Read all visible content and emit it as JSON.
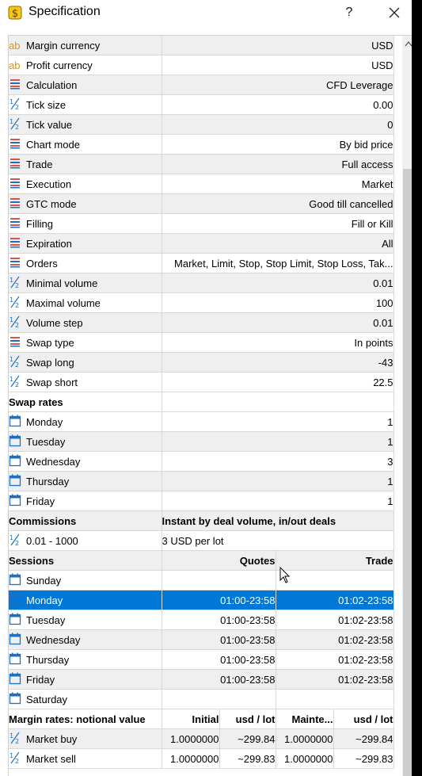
{
  "window": {
    "title": "Specification",
    "help": "?"
  },
  "props": [
    {
      "icon": "ab-icon",
      "name": "Margin currency",
      "value": "USD"
    },
    {
      "icon": "ab-icon",
      "name": "Profit currency",
      "value": "USD"
    },
    {
      "icon": "list-icon",
      "name": "Calculation",
      "value": "CFD Leverage"
    },
    {
      "icon": "half-icon",
      "name": "Tick size",
      "value": "0.00"
    },
    {
      "icon": "half-icon",
      "name": "Tick value",
      "value": "0"
    },
    {
      "icon": "list-icon",
      "name": "Chart mode",
      "value": "By bid price"
    },
    {
      "icon": "list-icon",
      "name": "Trade",
      "value": "Full access"
    },
    {
      "icon": "list-icon",
      "name": "Execution",
      "value": "Market"
    },
    {
      "icon": "list-icon",
      "name": "GTC mode",
      "value": "Good till cancelled"
    },
    {
      "icon": "list-icon",
      "name": "Filling",
      "value": "Fill or Kill"
    },
    {
      "icon": "list-icon",
      "name": "Expiration",
      "value": "All"
    },
    {
      "icon": "list-icon",
      "name": "Orders",
      "value": "Market, Limit, Stop, Stop Limit, Stop Loss, Tak..."
    },
    {
      "icon": "half-icon",
      "name": "Minimal volume",
      "value": "0.01"
    },
    {
      "icon": "half-icon",
      "name": "Maximal volume",
      "value": "100"
    },
    {
      "icon": "half-icon",
      "name": "Volume step",
      "value": "0.01"
    },
    {
      "icon": "list-icon",
      "name": "Swap type",
      "value": "In points"
    },
    {
      "icon": "half-icon",
      "name": "Swap long",
      "value": "-43"
    },
    {
      "icon": "half-icon",
      "name": "Swap short",
      "value": "22.5"
    }
  ],
  "swap": {
    "header": "Swap rates",
    "rows": [
      {
        "day": "Monday",
        "value": "1"
      },
      {
        "day": "Tuesday",
        "value": "1"
      },
      {
        "day": "Wednesday",
        "value": "3"
      },
      {
        "day": "Thursday",
        "value": "1"
      },
      {
        "day": "Friday",
        "value": "1"
      }
    ]
  },
  "commissions": {
    "header": "Commissions",
    "type": "Instant by deal volume, in/out deals",
    "range": "0.01 - 1000",
    "value": "3 USD per lot"
  },
  "sessions": {
    "header": "Sessions",
    "col_quotes": "Quotes",
    "col_trade": "Trade",
    "rows": [
      {
        "day": "Sunday",
        "quotes": "",
        "trade": ""
      },
      {
        "day": "Monday",
        "quotes": "01:00-23:58",
        "trade": "01:02-23:58",
        "selected": true
      },
      {
        "day": "Tuesday",
        "quotes": "01:00-23:58",
        "trade": "01:02-23:58"
      },
      {
        "day": "Wednesday",
        "quotes": "01:00-23:58",
        "trade": "01:02-23:58"
      },
      {
        "day": "Thursday",
        "quotes": "01:00-23:58",
        "trade": "01:02-23:58"
      },
      {
        "day": "Friday",
        "quotes": "01:00-23:58",
        "trade": "01:02-23:58"
      },
      {
        "day": "Saturday",
        "quotes": "",
        "trade": ""
      }
    ]
  },
  "margin": {
    "header": "Margin rates: notional value",
    "col_initial": "Initial",
    "col_usd1": "usd / lot",
    "col_maint": "Mainte...",
    "col_usd2": "usd / lot",
    "rows": [
      {
        "name": "Market buy",
        "initial": "1.0000000",
        "usd1": "~299.84",
        "maint": "1.0000000",
        "usd2": "~299.84"
      },
      {
        "name": "Market sell",
        "initial": "1.0000000",
        "usd1": "~299.83",
        "maint": "1.0000000",
        "usd2": "~299.83"
      }
    ]
  },
  "colors": {
    "selection": "#0078d7",
    "row_alt": "#efefef",
    "icon_blue": "#1e6fbf",
    "icon_red": "#d9534f",
    "icon_orange": "#d4952a"
  }
}
